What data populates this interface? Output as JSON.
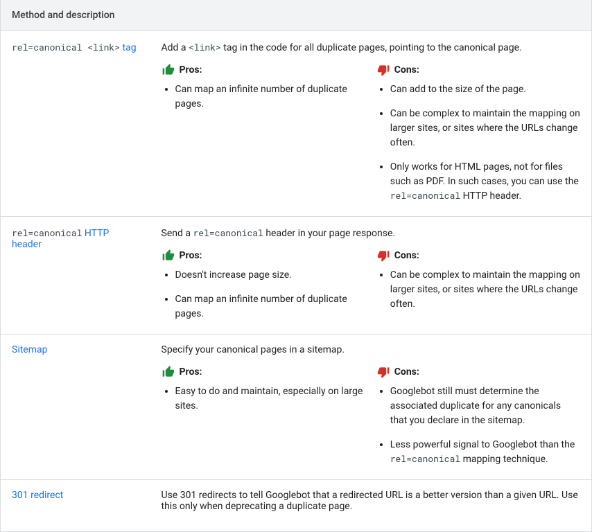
{
  "header": "Method and description",
  "labels": {
    "pros": "Pros:",
    "cons": "Cons:"
  },
  "rows": [
    {
      "method_parts": [
        {
          "t": "code",
          "v": "rel=canonical <link>"
        },
        {
          "t": "text",
          "v": " tag"
        }
      ],
      "desc_parts": [
        {
          "t": "text",
          "v": "Add a "
        },
        {
          "t": "code",
          "v": "<link>"
        },
        {
          "t": "text",
          "v": " tag in the code for all duplicate pages, pointing to the canonical page."
        }
      ],
      "pros": [
        [
          {
            "t": "text",
            "v": "Can map an infinite number of duplicate pages."
          }
        ]
      ],
      "cons": [
        [
          {
            "t": "text",
            "v": "Can add to the size of the page."
          }
        ],
        [
          {
            "t": "text",
            "v": "Can be complex to maintain the mapping on larger sites, or sites where the URLs change often."
          }
        ],
        [
          {
            "t": "text",
            "v": "Only works for HTML pages, not for files such as PDF. In such cases, you can use the "
          },
          {
            "t": "code",
            "v": "rel=canonical"
          },
          {
            "t": "text",
            "v": " HTTP header."
          }
        ]
      ]
    },
    {
      "method_parts": [
        {
          "t": "code",
          "v": "rel=canonical"
        },
        {
          "t": "text",
          "v": " HTTP header"
        }
      ],
      "desc_parts": [
        {
          "t": "text",
          "v": "Send a "
        },
        {
          "t": "code",
          "v": "rel=canonical"
        },
        {
          "t": "text",
          "v": " header in your page response."
        }
      ],
      "pros": [
        [
          {
            "t": "text",
            "v": "Doesn't increase page size."
          }
        ],
        [
          {
            "t": "text",
            "v": "Can map an infinite number of duplicate pages."
          }
        ]
      ],
      "cons": [
        [
          {
            "t": "text",
            "v": "Can be complex to maintain the mapping on larger sites, or sites where the URLs change often."
          }
        ]
      ]
    },
    {
      "method_parts": [
        {
          "t": "text",
          "v": "Sitemap"
        }
      ],
      "desc_parts": [
        {
          "t": "text",
          "v": "Specify your canonical pages in a sitemap."
        }
      ],
      "pros": [
        [
          {
            "t": "text",
            "v": "Easy to do and maintain, especially on large sites."
          }
        ]
      ],
      "cons": [
        [
          {
            "t": "text",
            "v": "Googlebot still must determine the associated duplicate for any canonicals that you declare in the sitemap."
          }
        ],
        [
          {
            "t": "text",
            "v": "Less powerful signal to Googlebot than the "
          },
          {
            "t": "code",
            "v": "rel=canonical"
          },
          {
            "t": "text",
            "v": " mapping technique."
          }
        ]
      ]
    },
    {
      "method_parts": [
        {
          "t": "text",
          "v": "301 redirect"
        }
      ],
      "desc_parts": [
        {
          "t": "text",
          "v": "Use 301 redirects to tell Googlebot that a redirected URL is a better version than a given URL. Use this only when deprecating a duplicate page."
        }
      ],
      "pros": [],
      "cons": []
    }
  ]
}
